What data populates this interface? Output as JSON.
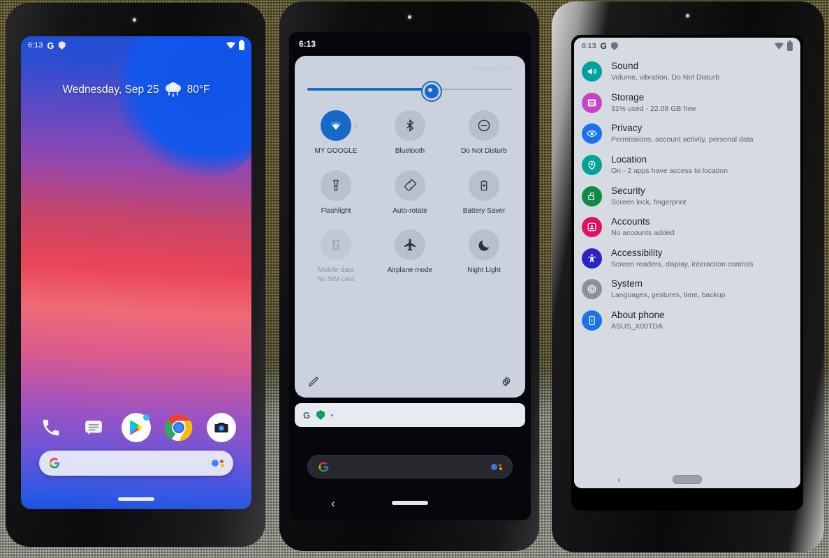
{
  "scene": {
    "description": "Three Android phones photographed side by side on a woven fabric surface",
    "background_color": "#6b6136"
  },
  "phone1": {
    "label": "home-screen-phone",
    "status_bar": {
      "time": "6:13",
      "google_logo": "G",
      "shield_icon": "shield-icon",
      "wifi_icon": "wifi-icon",
      "battery_icon": "battery-icon"
    },
    "at_a_glance": {
      "date": "Wednesday, Sep 25",
      "weather_icon": "rain-cloud-icon",
      "temperature": "80°F"
    },
    "dock": [
      {
        "name": "phone-app-icon",
        "label": "Phone"
      },
      {
        "name": "messages-app-icon",
        "label": "Messages"
      },
      {
        "name": "play-store-app-icon",
        "label": "Play Store"
      },
      {
        "name": "chrome-app-icon",
        "label": "Chrome"
      },
      {
        "name": "camera-app-icon",
        "label": "Camera"
      }
    ],
    "search_bar": {
      "google_icon": "google-g-icon",
      "assistant_icon": "google-assistant-icon",
      "placeholder": ""
    },
    "nav": {
      "home_pill": "home-gesture-pill"
    }
  },
  "phone2": {
    "label": "quick-settings-phone",
    "status_bar": {
      "time": "6:13"
    },
    "panel": {
      "carrier_text": "emergency call",
      "brightness": {
        "icon": "brightness-icon",
        "value_percent": 58
      }
    },
    "tiles": [
      {
        "label": "MY GOOGLE",
        "sub": "",
        "icon": "wifi-icon",
        "state": "on"
      },
      {
        "label": "Bluetooth",
        "sub": "",
        "icon": "bluetooth-icon",
        "state": "off"
      },
      {
        "label": "Do Not Disturb",
        "sub": "",
        "icon": "do-not-disturb-icon",
        "state": "off"
      },
      {
        "label": "Flashlight",
        "sub": "",
        "icon": "flashlight-icon",
        "state": "off"
      },
      {
        "label": "Auto-rotate",
        "sub": "",
        "icon": "auto-rotate-icon",
        "state": "off"
      },
      {
        "label": "Battery Saver",
        "sub": "",
        "icon": "battery-saver-icon",
        "state": "off"
      },
      {
        "label": "Mobile data",
        "sub": "No SIM card",
        "icon": "mobile-data-off-icon",
        "state": "disabled"
      },
      {
        "label": "Airplane mode",
        "sub": "",
        "icon": "airplane-icon",
        "state": "off"
      },
      {
        "label": "Night Light",
        "sub": "",
        "icon": "moon-icon",
        "state": "off"
      }
    ],
    "footer": {
      "edit_icon": "pencil-edit-icon",
      "settings_icon": "gear-icon"
    },
    "search_bar": {
      "google_icon": "google-g-icon",
      "shield_icon": "green-shield-icon",
      "dot_icon": "dot-icon"
    },
    "home_search_pill": {
      "google_icon": "google-g-icon",
      "assistant_icon": "google-assistant-icon"
    },
    "nav": {
      "back": "back-chevron-icon",
      "home_pill": "home-gesture-pill"
    }
  },
  "phone3": {
    "label": "settings-phone",
    "status_bar": {
      "time": "6:13",
      "google_logo": "G",
      "shield_icon": "shield-icon",
      "wifi_icon": "wifi-icon",
      "battery_icon": "battery-icon"
    },
    "settings_items": [
      {
        "title": "Sound",
        "subtitle": "Volume, vibration, Do Not Disturb",
        "icon": "sound-icon",
        "color": "#00a0a0"
      },
      {
        "title": "Storage",
        "subtitle": "31% used - 22.08 GB free",
        "icon": "storage-icon",
        "color": "#c843c8"
      },
      {
        "title": "Privacy",
        "subtitle": "Permissions, account activity, personal data",
        "icon": "privacy-eye-icon",
        "color": "#1a73e8"
      },
      {
        "title": "Location",
        "subtitle": "On - 2 apps have access to location",
        "icon": "location-pin-icon",
        "color": "#00a396"
      },
      {
        "title": "Security",
        "subtitle": "Screen lock, fingerprint",
        "icon": "lock-icon",
        "color": "#0f8a45"
      },
      {
        "title": "Accounts",
        "subtitle": "No accounts added",
        "icon": "accounts-icon",
        "color": "#e0115f"
      },
      {
        "title": "Accessibility",
        "subtitle": "Screen readers, display, interaction controls",
        "icon": "accessibility-icon",
        "color": "#2a23c8"
      },
      {
        "title": "System",
        "subtitle": "Languages, gestures, time, backup",
        "icon": "system-info-icon",
        "color": "#8c9099"
      },
      {
        "title": "About phone",
        "subtitle": "ASUS_X00TDA",
        "icon": "about-phone-icon",
        "color": "#1a73e8"
      }
    ],
    "nav": {
      "back": "back-chevron-icon",
      "home_pill": "home-button-pill"
    }
  }
}
